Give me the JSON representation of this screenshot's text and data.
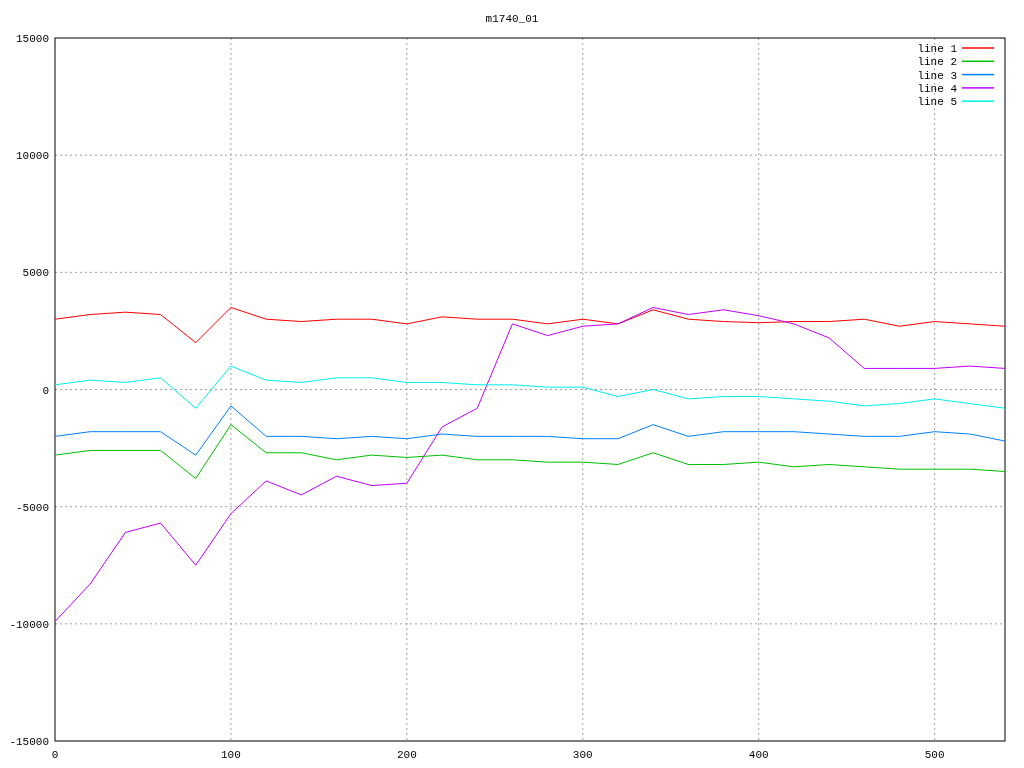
{
  "chart_data": {
    "type": "line",
    "title": "m1740_01",
    "x": [
      0,
      20,
      40,
      60,
      80,
      100,
      120,
      140,
      160,
      180,
      200,
      220,
      240,
      260,
      280,
      300,
      320,
      340,
      360,
      380,
      400,
      420,
      440,
      460,
      480,
      500,
      520,
      540
    ],
    "xlim": [
      0,
      540
    ],
    "ylim": [
      -15000,
      15000
    ],
    "xticks": [
      0,
      100,
      200,
      300,
      400,
      500
    ],
    "yticks": [
      -15000,
      -10000,
      -5000,
      0,
      5000,
      10000,
      15000
    ],
    "grid": true,
    "legend": true,
    "series": [
      {
        "name": "line 1",
        "color": "#ff0000",
        "values": [
          3000,
          3200,
          3300,
          3200,
          2000,
          3500,
          3000,
          2900,
          3000,
          3000,
          2800,
          3100,
          3000,
          3000,
          2800,
          3000,
          2800,
          3400,
          3000,
          2900,
          2850,
          2900,
          2900,
          3000,
          2700,
          2900,
          2800,
          2700
        ]
      },
      {
        "name": "line 2",
        "color": "#00c000",
        "values": [
          -2800,
          -2600,
          -2600,
          -2600,
          -3800,
          -1500,
          -2700,
          -2700,
          -3000,
          -2800,
          -2900,
          -2800,
          -3000,
          -3000,
          -3100,
          -3100,
          -3200,
          -2700,
          -3200,
          -3200,
          -3100,
          -3300,
          -3200,
          -3300,
          -3400,
          -3400,
          -3400,
          -3500
        ]
      },
      {
        "name": "line 3",
        "color": "#0080ff",
        "values": [
          -2000,
          -1800,
          -1800,
          -1800,
          -2800,
          -700,
          -2000,
          -2000,
          -2100,
          -2000,
          -2100,
          -1900,
          -2000,
          -2000,
          -2000,
          -2100,
          -2100,
          -1500,
          -2000,
          -1800,
          -1800,
          -1800,
          -1900,
          -2000,
          -2000,
          -1800,
          -1900,
          -2200
        ]
      },
      {
        "name": "line 4",
        "color": "#c000ff",
        "values": [
          -9900,
          -8300,
          -6100,
          -5700,
          -7500,
          -5300,
          -3900,
          -4500,
          -3700,
          -4100,
          -4000,
          -1600,
          -800,
          2800,
          2300,
          2700,
          2800,
          3500,
          3200,
          3400,
          3150,
          2800,
          2200,
          900,
          900,
          900,
          1000,
          900
        ]
      },
      {
        "name": "line 5",
        "color": "#00eeee",
        "values": [
          200,
          400,
          300,
          500,
          -800,
          1000,
          400,
          300,
          500,
          500,
          300,
          300,
          200,
          200,
          100,
          100,
          -300,
          0,
          -400,
          -300,
          -300,
          -400,
          -500,
          -700,
          -600,
          -400,
          -600,
          -800
        ]
      }
    ]
  }
}
